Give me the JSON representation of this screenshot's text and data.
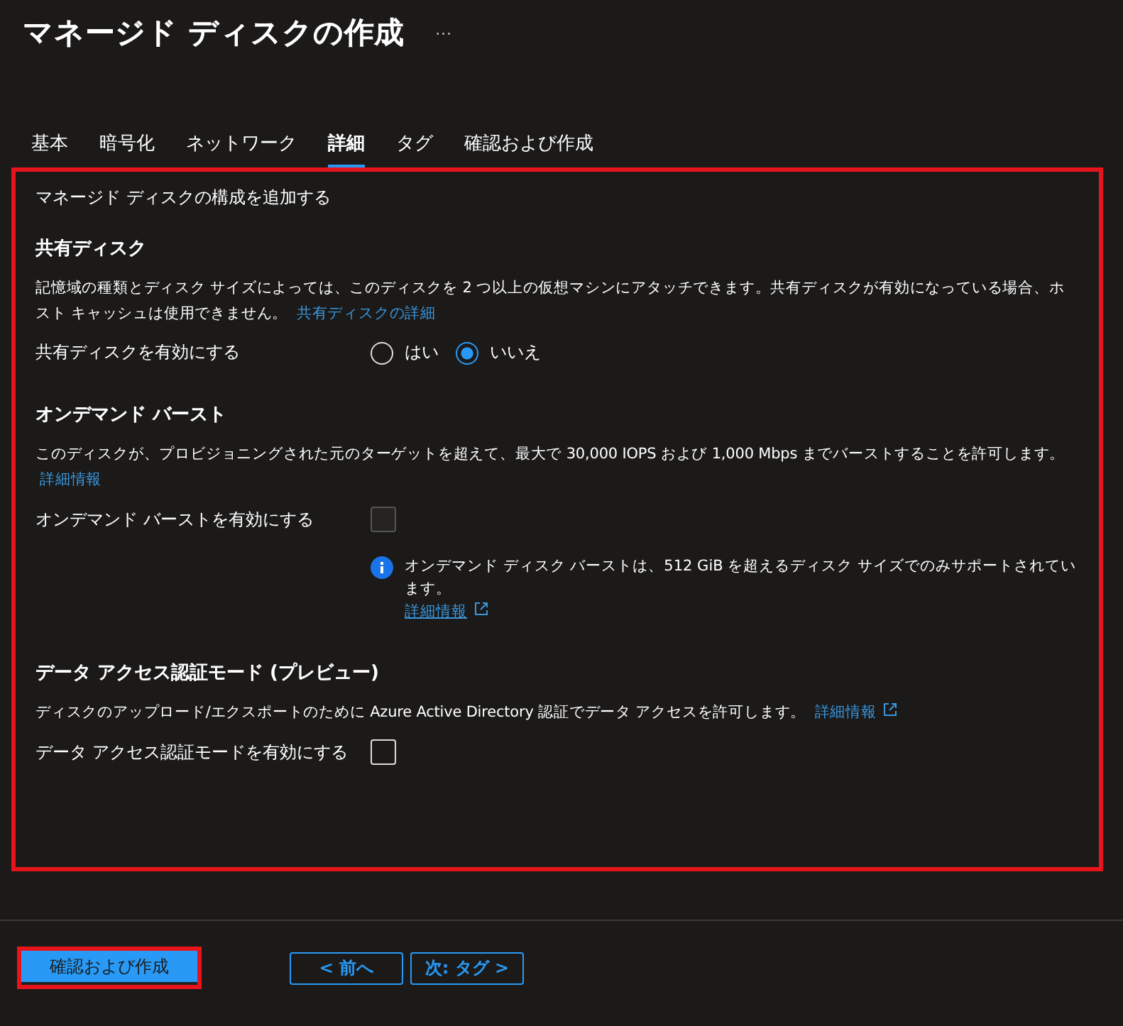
{
  "title": "マネージド ディスクの作成",
  "more": "···",
  "tabs": [
    {
      "label": "基本",
      "selected": false
    },
    {
      "label": "暗号化",
      "selected": false
    },
    {
      "label": "ネットワーク",
      "selected": false
    },
    {
      "label": "詳細",
      "selected": true
    },
    {
      "label": "タグ",
      "selected": false
    },
    {
      "label": "確認および作成",
      "selected": false
    }
  ],
  "intro": "マネージド ディスクの構成を追加する",
  "sections": [
    {
      "heading": "共有ディスク",
      "description": "記憶域の種類とディスク サイズによっては、このディスクを 2 つ以上の仮想マシンにアタッチできます。共有ディスクが有効になっている場合、ホスト キャッシュは使用できません。",
      "link": "共有ディスクの詳細",
      "link_external": false,
      "control": {
        "kind": "radio",
        "label": "共有ディスクを有効にする",
        "options": [
          {
            "label": "はい",
            "selected": false
          },
          {
            "label": "いいえ",
            "selected": true
          }
        ]
      }
    },
    {
      "heading": "オンデマンド バースト",
      "description": "このディスクが、プロビジョニングされた元のターゲットを超えて、最大で 30,000 IOPS および 1,000 Mbps までバーストすることを許可します。",
      "link": "詳細情報",
      "link_external": false,
      "control": {
        "kind": "checkbox",
        "label": "オンデマンド バーストを有効にする",
        "checked": false,
        "disabled": true
      },
      "note": {
        "text": "オンデマンド ディスク バーストは、512 GiB を超えるディスク サイズでのみサポートされています。",
        "link": "詳細情報"
      }
    },
    {
      "heading": "データ アクセス認証モード (プレビュー)",
      "description": "ディスクのアップロード/エクスポートのために Azure Active Directory 認証でデータ アクセスを許可します。",
      "link": "詳細情報",
      "link_external": true,
      "control": {
        "kind": "checkbox",
        "label": "データ アクセス認証モードを有効にする",
        "checked": false,
        "disabled": false
      }
    }
  ],
  "footer": {
    "primary": "確認および作成",
    "previous": "< 前へ",
    "next": "次: タグ >"
  }
}
